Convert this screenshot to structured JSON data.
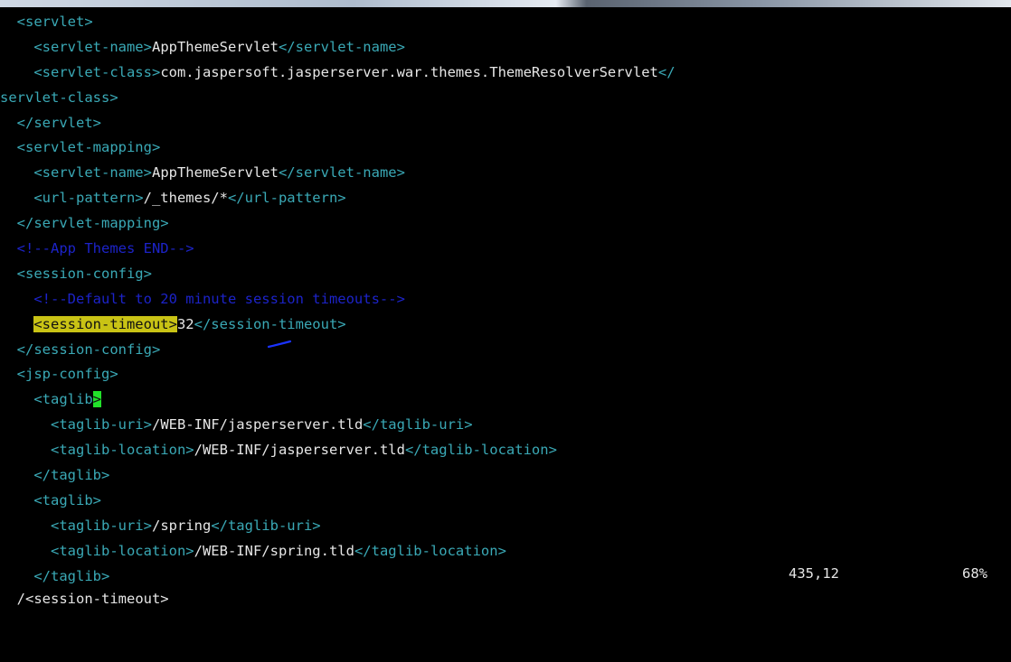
{
  "editor": {
    "lines": [
      [
        {
          "c": "t",
          "s": "  <servlet>"
        }
      ],
      [
        {
          "c": "t",
          "s": "    <servlet-name>"
        },
        {
          "c": "x",
          "s": "AppThemeServlet"
        },
        {
          "c": "t",
          "s": "</servlet-name>"
        }
      ],
      [
        {
          "c": "t",
          "s": "    <servlet-class>"
        },
        {
          "c": "x",
          "s": "com.jaspersoft.jasperserver.war.themes.ThemeResolverServlet"
        },
        {
          "c": "t",
          "s": "</"
        }
      ],
      [
        {
          "c": "t",
          "s": "servlet-class>"
        }
      ],
      [
        {
          "c": "t",
          "s": "  </servlet>"
        }
      ],
      [
        {
          "c": "t",
          "s": "  <servlet-mapping>"
        }
      ],
      [
        {
          "c": "t",
          "s": "    <servlet-name>"
        },
        {
          "c": "x",
          "s": "AppThemeServlet"
        },
        {
          "c": "t",
          "s": "</servlet-name>"
        }
      ],
      [
        {
          "c": "t",
          "s": "    <url-pattern>"
        },
        {
          "c": "x",
          "s": "/_themes/*"
        },
        {
          "c": "t",
          "s": "</url-pattern>"
        }
      ],
      [
        {
          "c": "t",
          "s": "  </servlet-mapping>"
        }
      ],
      [
        {
          "c": "c",
          "s": "  <!--App Themes END-->"
        }
      ],
      [
        {
          "c": "t",
          "s": "  <session-config>"
        }
      ],
      [
        {
          "c": "c",
          "s": "    <!--Default to 20 minute session timeouts-->"
        }
      ],
      [
        {
          "c": "t",
          "s": "    "
        },
        {
          "c": "hl",
          "s": "<session-timeout>"
        },
        {
          "c": "x",
          "s": "32"
        },
        {
          "c": "t",
          "s": "</session-timeout>"
        }
      ],
      [
        {
          "c": "t",
          "s": "  </session-config>"
        }
      ],
      [
        {
          "c": "t",
          "s": "  <jsp-config>"
        }
      ],
      [
        {
          "c": "t",
          "s": "    <taglib"
        },
        {
          "c": "cur",
          "s": ">"
        }
      ],
      [
        {
          "c": "t",
          "s": "      <taglib-uri>"
        },
        {
          "c": "x",
          "s": "/WEB-INF/jasperserver.tld"
        },
        {
          "c": "t",
          "s": "</taglib-uri>"
        }
      ],
      [
        {
          "c": "t",
          "s": "      <taglib-location>"
        },
        {
          "c": "x",
          "s": "/WEB-INF/jasperserver.tld"
        },
        {
          "c": "t",
          "s": "</taglib-location>"
        }
      ],
      [
        {
          "c": "t",
          "s": "    </taglib>"
        }
      ],
      [
        {
          "c": "t",
          "s": "    <taglib>"
        }
      ],
      [
        {
          "c": "t",
          "s": "      <taglib-uri>"
        },
        {
          "c": "x",
          "s": "/spring"
        },
        {
          "c": "t",
          "s": "</taglib-uri>"
        }
      ],
      [
        {
          "c": "t",
          "s": "      <taglib-location>"
        },
        {
          "c": "x",
          "s": "/WEB-INF/spring.tld"
        },
        {
          "c": "t",
          "s": "</taglib-location>"
        }
      ],
      [
        {
          "c": "t",
          "s": "    </taglib>"
        }
      ]
    ]
  },
  "status": {
    "command": "/<session-timeout>",
    "position": "435,12",
    "percent": "68%"
  },
  "colors": {
    "background": "#000000",
    "tag": "#3aa9b6",
    "text": "#e6e6e6",
    "comment": "#1c23c9",
    "search_highlight": "#c9c315",
    "cursor": "#22e22a"
  }
}
